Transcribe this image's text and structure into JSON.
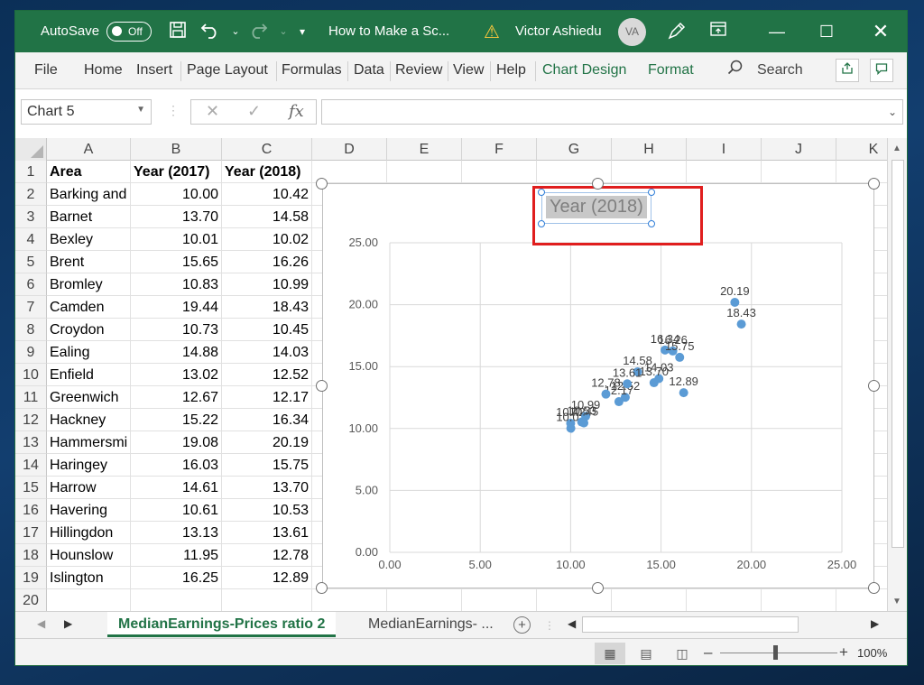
{
  "titlebar": {
    "autosave_label": "AutoSave",
    "autosave_state": "Off",
    "doc_title": "How to Make a Sc...",
    "user_name": "Victor Ashiedu",
    "user_initials": "VA"
  },
  "ribbon": {
    "tabs": [
      "File",
      "Home",
      "Insert",
      "Page Layout",
      "Formulas",
      "Data",
      "Review",
      "View",
      "Help",
      "Chart Design",
      "Format"
    ],
    "search_label": "Search"
  },
  "namebox": {
    "value": "Chart 5"
  },
  "grid": {
    "column_headers": [
      "A",
      "B",
      "C",
      "D",
      "E",
      "F",
      "G",
      "H",
      "I",
      "J",
      "K"
    ],
    "row_numbers": [
      "1",
      "2",
      "3",
      "4",
      "5",
      "6",
      "7",
      "8",
      "9",
      "10",
      "11",
      "12",
      "13",
      "14",
      "15",
      "16",
      "17",
      "18",
      "19",
      "20"
    ],
    "header_row": [
      "Area",
      "Year (2017)",
      "Year (2018)"
    ],
    "rows": [
      [
        "Barking and",
        "10.00",
        "10.42"
      ],
      [
        "Barnet",
        "13.70",
        "14.58"
      ],
      [
        "Bexley",
        "10.01",
        "10.02"
      ],
      [
        "Brent",
        "15.65",
        "16.26"
      ],
      [
        "Bromley",
        "10.83",
        "10.99"
      ],
      [
        "Camden",
        "19.44",
        "18.43"
      ],
      [
        "Croydon",
        "10.73",
        "10.45"
      ],
      [
        "Ealing",
        "14.88",
        "14.03"
      ],
      [
        "Enfield",
        "13.02",
        "12.52"
      ],
      [
        "Greenwich",
        "12.67",
        "12.17"
      ],
      [
        "Hackney",
        "15.22",
        "16.34"
      ],
      [
        "Hammersmi",
        "19.08",
        "20.19"
      ],
      [
        "Haringey",
        "16.03",
        "15.75"
      ],
      [
        "Harrow",
        "14.61",
        "13.70"
      ],
      [
        "Havering",
        "10.61",
        "10.53"
      ],
      [
        "Hillingdon",
        "13.13",
        "13.61"
      ],
      [
        "Hounslow",
        "11.95",
        "12.78"
      ],
      [
        "Islington",
        "16.25",
        "12.89"
      ]
    ]
  },
  "chart_data": {
    "type": "scatter",
    "title": "Year (2018)",
    "xlim": [
      0,
      25
    ],
    "ylim": [
      0,
      25
    ],
    "x_ticks": [
      "0.00",
      "5.00",
      "10.00",
      "15.00",
      "20.00",
      "25.00"
    ],
    "y_ticks": [
      "0.00",
      "5.00",
      "10.00",
      "15.00",
      "20.00",
      "25.00"
    ],
    "grid": true,
    "data_labels": true,
    "series": [
      {
        "color": "#5b9bd5",
        "points": [
          {
            "x": 10.0,
            "y": 10.42,
            "label": "10.42"
          },
          {
            "x": 13.7,
            "y": 14.58,
            "label": "14.58"
          },
          {
            "x": 10.01,
            "y": 10.02,
            "label": "10.02"
          },
          {
            "x": 15.65,
            "y": 16.26,
            "label": "16.26"
          },
          {
            "x": 10.83,
            "y": 10.99,
            "label": "10.99"
          },
          {
            "x": 19.44,
            "y": 18.43,
            "label": "18.43"
          },
          {
            "x": 10.73,
            "y": 10.45,
            "label": "10.45"
          },
          {
            "x": 14.88,
            "y": 14.03,
            "label": "14.03"
          },
          {
            "x": 13.02,
            "y": 12.52,
            "label": "12.52"
          },
          {
            "x": 12.67,
            "y": 12.17,
            "label": "12.17"
          },
          {
            "x": 15.22,
            "y": 16.34,
            "label": "16.34"
          },
          {
            "x": 19.08,
            "y": 20.19,
            "label": "20.19"
          },
          {
            "x": 16.03,
            "y": 15.75,
            "label": "15.75"
          },
          {
            "x": 14.61,
            "y": 13.7,
            "label": "13.70"
          },
          {
            "x": 10.61,
            "y": 10.53,
            "label": "10.53"
          },
          {
            "x": 13.13,
            "y": 13.61,
            "label": "13.61"
          },
          {
            "x": 11.95,
            "y": 12.78,
            "label": "12.78"
          },
          {
            "x": 16.25,
            "y": 12.89,
            "label": "12.89"
          }
        ]
      }
    ]
  },
  "sheets": {
    "active": "MedianEarnings-Prices ratio 2",
    "other": "MedianEarnings- ..."
  },
  "status": {
    "zoom": "100%"
  },
  "colors": {
    "accent": "#217346",
    "highlight": "#e01e1e",
    "marker": "#5b9bd5"
  },
  "icons": [
    "save-icon",
    "undo-icon",
    "redo-icon",
    "customize-icon",
    "warning-icon",
    "pen-icon",
    "ribbon-display-icon",
    "minimize-icon",
    "maximize-icon",
    "close-icon",
    "search-icon",
    "share-icon",
    "comments-icon",
    "cancel-icon",
    "enter-icon",
    "fx-icon"
  ]
}
